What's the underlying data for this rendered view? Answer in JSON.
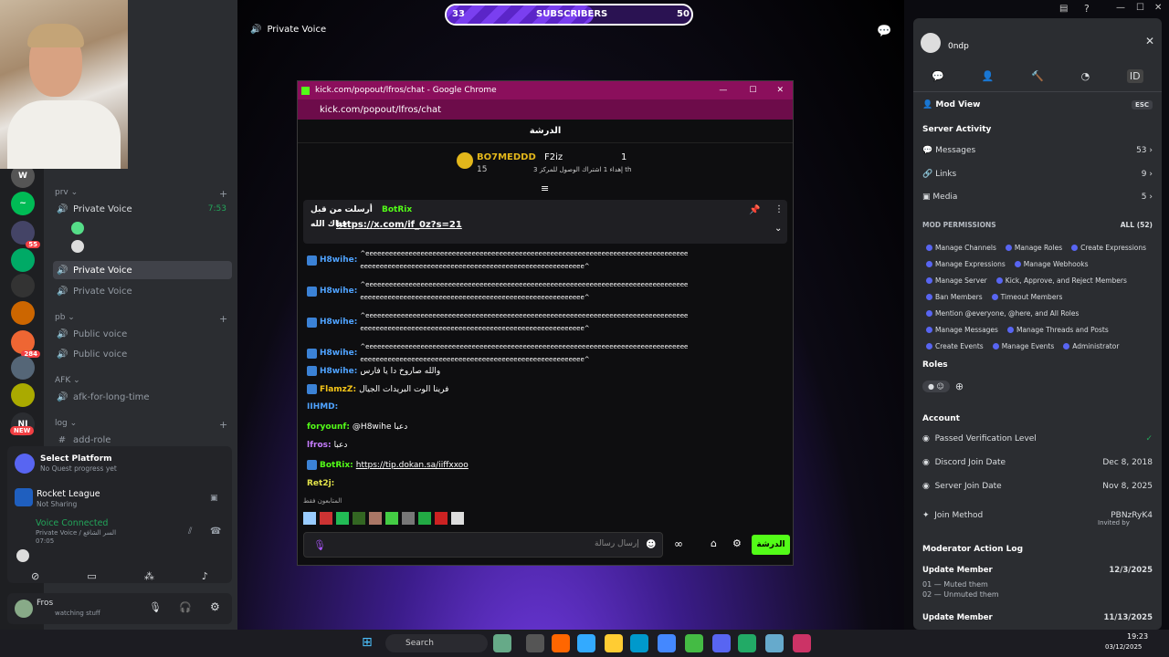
{
  "overlay": {
    "sub_left": "33",
    "sub_label": "SUBSCRIBERS",
    "sub_right": "50",
    "sub_progress": 0.6
  },
  "stream": {
    "channel": "Private Voice"
  },
  "discord": {
    "categories": [
      {
        "label": "prv ⌄"
      },
      {
        "label": "pb ⌄"
      },
      {
        "label": "AFK ⌄"
      },
      {
        "label": "log ⌄"
      }
    ],
    "private_voice_1": "Private Voice",
    "private_voice_1_time": "7:53",
    "private_voice_2": "Private Voice",
    "private_voice_3": "Private Voice",
    "public_voice_1": "Public voice",
    "public_voice_2": "Public voice",
    "afk": "afk-for-long-time",
    "add_role": "add-role",
    "server_badges": [
      "55",
      "284"
    ],
    "server_ni": "NI",
    "new_badge": "NEW",
    "quest_title": "Select Platform",
    "quest_sub": "No Quest progress yet",
    "game_title": "Rocket League",
    "game_sub": "Not Sharing",
    "voice_status": "Voice Connected",
    "voice_channel": "Private Voice / السر الشافع",
    "voice_time": "07:05",
    "user_name": "Fros",
    "user_status": "watching stuff"
  },
  "chrome": {
    "tab_title": "kick.com/popout/lfros/chat - Google Chrome",
    "url": "kick.com/popout/lfros/chat",
    "chat_title": "الدرشة",
    "top_user_1": "BO7MEDDD",
    "top_user_1_count": "15",
    "top_user_2": "F2iz",
    "top_user_2_sub": "إهداء 1 اشتراك الوصول للمركز 3 th",
    "top_rank_2": "1",
    "pinned_by": "أرسلت من قبل",
    "pinned_user": "BotRix",
    "pinned_text": "حياك الله",
    "pinned_link": "https://x.com/if_0z?s=21",
    "messages": [
      {
        "user": "H8wihe:",
        "text": "^eeeeeeeeeeeeeeeeeeeeeeeeeeeeeeeeeeeeeeeeeeeeeeeeeeeeeeeeeeeeeeeeeeeeeeeeeeeeeeeeeeeeeeeeeeeeeeeeeeeeeeeeeeeeeeeeeeeeeeeeeeeeeeeeeeeeeeeeeee^"
      },
      {
        "user": "H8wihe:",
        "text": "^eeeeeeeeeeeeeeeeeeeeeeeeeeeeeeeeeeeeeeeeeeeeeeeeeeeeeeeeeeeeeeeeeeeeeeeeeeeeeeeeeeeeeeeeeeeeeeeeeeeeeeeeeeeeeeeeeeeeeeeeeeeeeeeeeeeeeeeeeee^"
      },
      {
        "user": "H8wihe:",
        "text": "^eeeeeeeeeeeeeeeeeeeeeeeeeeeeeeeeeeeeeeeeeeeeeeeeeeeeeeeeeeeeeeeeeeeeeeeeeeeeeeeeeeeeeeeeeeeeeeeeeeeeeeeeeeeeeeeeeeeeeeeeeeeeeeeeeeeeeeeeeee^"
      },
      {
        "user": "H8wihe:",
        "text": "^eeeeeeeeeeeeeeeeeeeeeeeeeeeeeeeeeeeeeeeeeeeeeeeeeeeeeeeeeeeeeeeeeeeeeeeeeeeeeeeeeeeeeeeeeeeeeeeeeeeeeeeeeeeeeeeeeeeeeeeeeeeeeeeeeeeeeeeeeee^"
      },
      {
        "user": "H8wihe:",
        "text": "والله صاروخ دا يا فارس"
      },
      {
        "user": "FlamzZ:",
        "text": "فرينا الوت البريدات الجيال"
      },
      {
        "user": "IIHMD:",
        "text": ""
      },
      {
        "user": "foryounf:",
        "text": "@H8wihe دعبا"
      },
      {
        "user": "lfros:",
        "text": "دعبا"
      },
      {
        "user": "BotRix:",
        "text": "https://tip.dokan.sa/iiffxxoo"
      },
      {
        "user": "Ret2j:",
        "text": ""
      }
    ],
    "followers_only": "المتابعون فقط",
    "input_placeholder": "إرسال رسالة",
    "send_label": "الدرشة"
  },
  "right": {
    "username": "0ndp",
    "mod_view": "Mod View",
    "esc": "ESC",
    "server_activity": "Server Activity",
    "activity": [
      {
        "label": "Messages",
        "value": "53"
      },
      {
        "label": "Links",
        "value": "9"
      },
      {
        "label": "Media",
        "value": "5"
      }
    ],
    "mod_permissions": "MOD PERMISSIONS",
    "all_count": "ALL (52)",
    "permissions": [
      "Manage Channels",
      "Manage Roles",
      "Create Expressions",
      "Manage Expressions",
      "Manage Webhooks",
      "Manage Server",
      "Kick, Approve, and Reject Members",
      "Ban Members",
      "Timeout Members",
      "Mention @everyone, @here, and All Roles",
      "Manage Messages",
      "Manage Threads and Posts",
      "Create Events",
      "Manage Events",
      "Administrator"
    ],
    "roles": "Roles",
    "account": "Account",
    "account_rows": [
      {
        "label": "Passed Verification Level",
        "value": "✓"
      },
      {
        "label": "Discord Join Date",
        "value": "Dec 8, 2018"
      },
      {
        "label": "Server Join Date",
        "value": "Nov 8, 2025"
      },
      {
        "label": "Join Method",
        "value": "PBNzRyK4"
      }
    ],
    "invited_by": "Invited by",
    "action_log": "Moderator Action Log",
    "log": [
      {
        "title": "Update Member",
        "date": "12/3/2025",
        "items": [
          "01 — Muted them",
          "02 — Unmuted them"
        ]
      },
      {
        "title": "Update Member",
        "date": "11/13/2025"
      }
    ]
  },
  "taskbar": {
    "search": "Search",
    "time": "19:23",
    "date": "03/12/2025"
  }
}
